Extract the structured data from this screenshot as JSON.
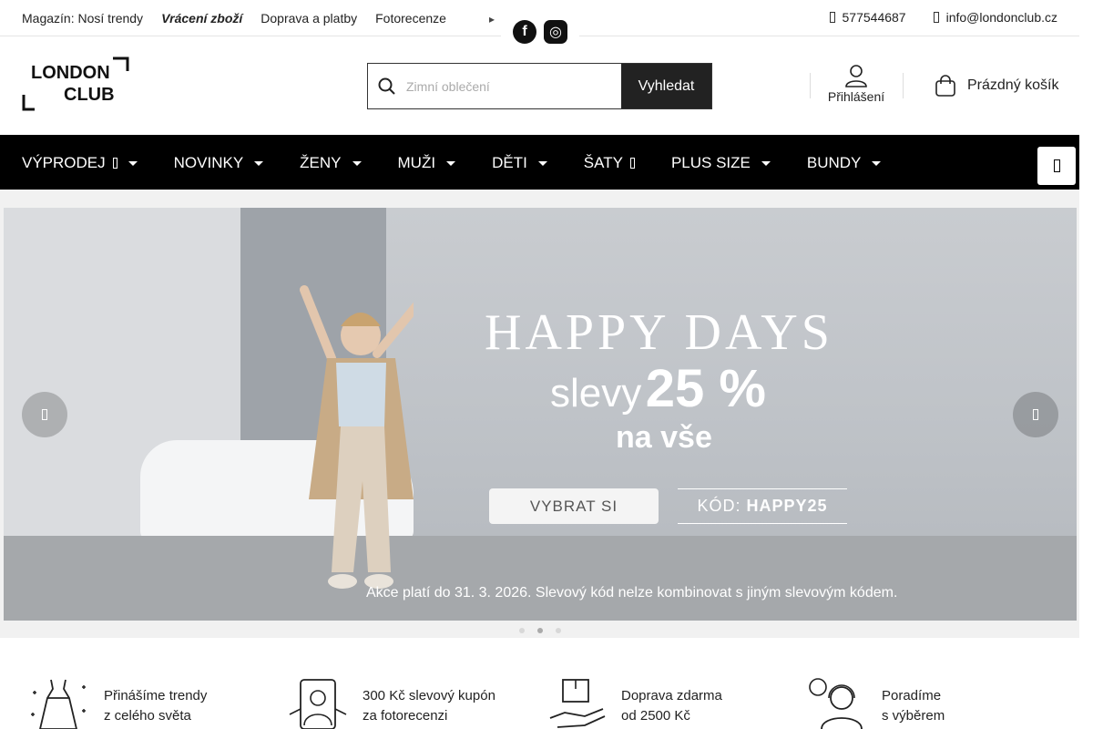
{
  "topbar": {
    "links": [
      {
        "label": "Magazín: Nosí trendy",
        "bold": false
      },
      {
        "label": "Vrácení zboží",
        "bold": true
      },
      {
        "label": "Doprava a platby",
        "bold": false
      },
      {
        "label": "Fotorecenze",
        "bold": false
      }
    ],
    "social": {
      "facebook": "f",
      "instagram": "◎"
    },
    "phone": "577544687",
    "email": "info@londonclub.cz"
  },
  "header": {
    "logo_line1": "LONDON",
    "logo_line2": "CLUB",
    "search_placeholder": "Zimní oblečení",
    "search_button": "Vyhledat",
    "login_label": "Přihlášení",
    "cart_label": "Prázdný košík"
  },
  "nav": {
    "items": [
      {
        "label": "VÝPRODEJ",
        "glyph": true,
        "caret": true
      },
      {
        "label": "NOVINKY",
        "glyph": false,
        "caret": true
      },
      {
        "label": "ŽENY",
        "glyph": false,
        "caret": true
      },
      {
        "label": "MUŽI",
        "glyph": false,
        "caret": true
      },
      {
        "label": "DĚTI",
        "glyph": false,
        "caret": true
      },
      {
        "label": "ŠATY",
        "glyph": true,
        "caret": false
      },
      {
        "label": "PLUS SIZE",
        "glyph": false,
        "caret": true
      },
      {
        "label": "BUNDY",
        "glyph": false,
        "caret": true
      }
    ]
  },
  "hero": {
    "title": "HAPPY DAYS",
    "slevy": "slevy",
    "percent": "25 %",
    "subtitle": "na vše",
    "cta": "VYBRAT SI",
    "code_label": "KÓD:",
    "code": "HAPPY25",
    "disclaimer": "Akce platí do 31. 3. 2026. Slevový kód nelze kombinovat s jiným slevovým kódem."
  },
  "benefits": [
    {
      "line1": "Přinášíme trendy",
      "line2": "z celého světa",
      "icon": "dress-icon"
    },
    {
      "line1": "300 Kč slevový kupón",
      "line2": "za fotorecenzi",
      "icon": "phone-photo-icon"
    },
    {
      "line1": "Doprava zdarma",
      "line2": "od 2500 Kč",
      "icon": "package-hand-icon"
    },
    {
      "line1": "Poradíme",
      "line2": "s výběrem",
      "icon": "support-agent-icon"
    }
  ],
  "colors": {
    "nav_bg": "#000000",
    "search_button_bg": "#222222",
    "accent_text": "#222222"
  }
}
